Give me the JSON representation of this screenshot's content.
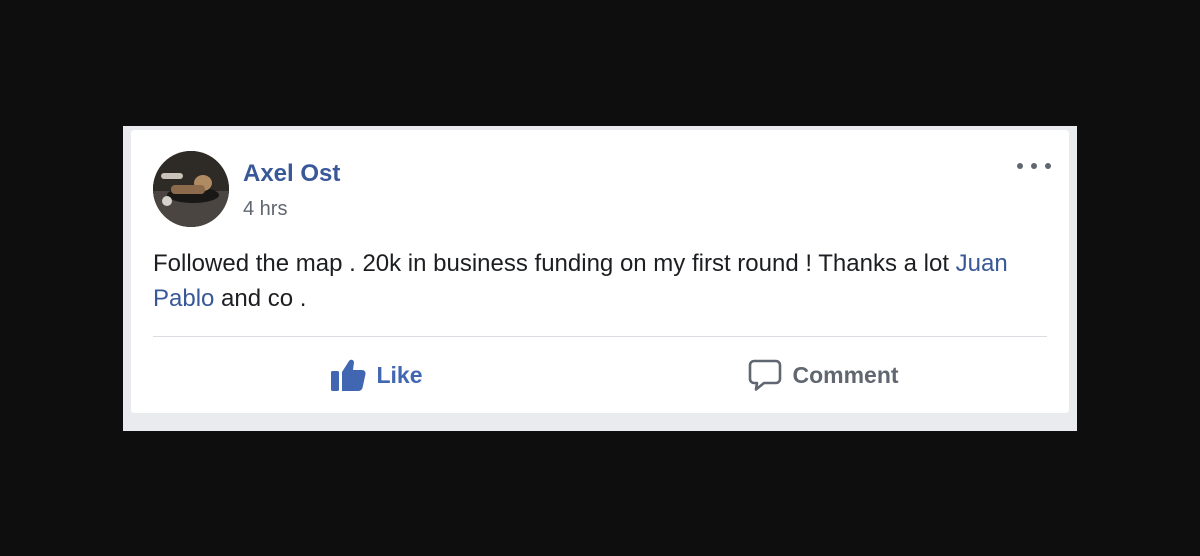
{
  "post": {
    "author": "Axel Ost",
    "timestamp": "4 hrs",
    "avatar_icon": "profile-photo",
    "menu_icon": "more-options-icon",
    "text_before_mention": "Followed the map . 20k in business funding on my first round ! Thanks a lot ",
    "mention": "Juan Pablo",
    "text_after_mention": " and co ."
  },
  "actions": {
    "like_label": "Like",
    "like_icon": "thumbs-up-icon",
    "comment_label": "Comment",
    "comment_icon": "speech-bubble-icon"
  },
  "colors": {
    "background": "#0e0e0e",
    "link_blue": "#385898",
    "like_blue": "#4267b2",
    "secondary_text": "#606770",
    "primary_text": "#1c1e21"
  }
}
